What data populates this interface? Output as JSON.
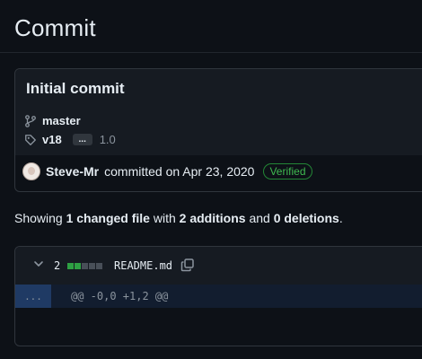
{
  "page": {
    "title": "Commit"
  },
  "commit": {
    "message": "Initial commit",
    "branch": "master",
    "tag": "v18",
    "more_button": "...",
    "tag_extra": "1.0",
    "author": "Steve-Mr",
    "committed_text": "committed on Apr 23, 2020",
    "verified_label": "Verified"
  },
  "summary": {
    "prefix": "Showing",
    "files_changed": "1 changed file",
    "with_text": "with",
    "additions": "2 additions",
    "and_text": "and",
    "deletions": "0 deletions",
    "suffix": "."
  },
  "file": {
    "change_count": "2",
    "diffstat": {
      "added": 2,
      "total": 5
    },
    "name": "README.md",
    "expand_label": "...",
    "hunk_header": "@@ -0,0 +1,2 @@"
  },
  "colors": {
    "background": "#0d1117",
    "accent_green": "#3fb950",
    "diff_add": "#2ea043",
    "hunk_bg": "#1f3a64"
  }
}
